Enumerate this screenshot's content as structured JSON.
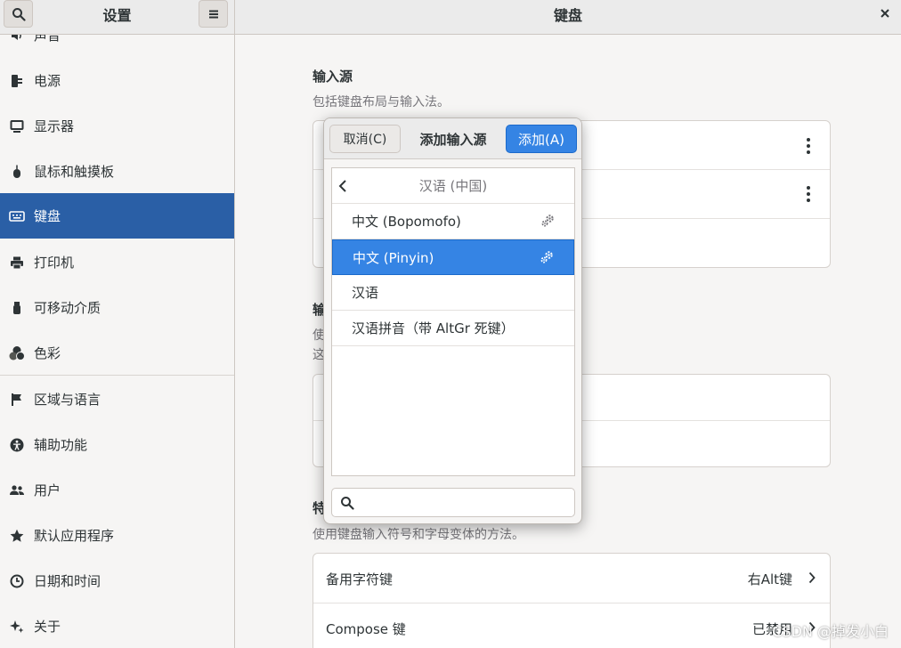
{
  "header": {
    "sidebar_title": "设置",
    "panel_title": "键盘"
  },
  "sidebar": {
    "items": [
      {
        "label": "声音",
        "icon": "speaker-icon"
      },
      {
        "label": "电源",
        "icon": "power-plug-icon"
      },
      {
        "label": "显示器",
        "icon": "monitor-icon"
      },
      {
        "label": "鼠标和触摸板",
        "icon": "mouse-icon"
      },
      {
        "label": "键盘",
        "icon": "keyboard-icon",
        "selected": true
      },
      {
        "label": "打印机",
        "icon": "printer-icon"
      },
      {
        "label": "可移动介质",
        "icon": "usb-drive-icon"
      },
      {
        "label": "色彩",
        "icon": "color-circles-icon"
      },
      {
        "label": "区域与语言",
        "icon": "flag-icon"
      },
      {
        "label": "辅助功能",
        "icon": "accessibility-icon"
      },
      {
        "label": "用户",
        "icon": "users-icon"
      },
      {
        "label": "默认应用程序",
        "icon": "star-icon"
      },
      {
        "label": "日期和时间",
        "icon": "clock-icon"
      },
      {
        "label": "关于",
        "icon": "sparkle-icon"
      }
    ]
  },
  "main": {
    "input_sources": {
      "title": "输入源",
      "description": "包括键盘布局与输入法。"
    },
    "section2": {
      "title_fragment": "输",
      "desc_fragment_1": "使",
      "desc_fragment_2": "这"
    },
    "special_chars": {
      "title_fragment": "特",
      "description": "使用键盘输入符号和字母变体的方法。",
      "rows": [
        {
          "label": "备用字符键",
          "value": "右Alt键"
        },
        {
          "label": "Compose 键",
          "value": "已禁用"
        }
      ]
    }
  },
  "dialog": {
    "cancel_label": "取消(C)",
    "title": "添加输入源",
    "add_label": "添加(A)",
    "list_header": "汉语 (中国)",
    "items": [
      {
        "label": "中文 (Bopomofo)",
        "has_settings": true
      },
      {
        "label": "中文 (Pinyin)",
        "has_settings": true,
        "selected": true
      },
      {
        "label": "汉语",
        "has_settings": false
      },
      {
        "label": "汉语拼音（带 AltGr 死键）",
        "has_settings": false
      }
    ],
    "search_placeholder": ""
  },
  "watermark": "CSDN @掉发小白",
  "colors": {
    "accent": "#3584e4",
    "sidebar_selected": "#2a5fa6"
  }
}
